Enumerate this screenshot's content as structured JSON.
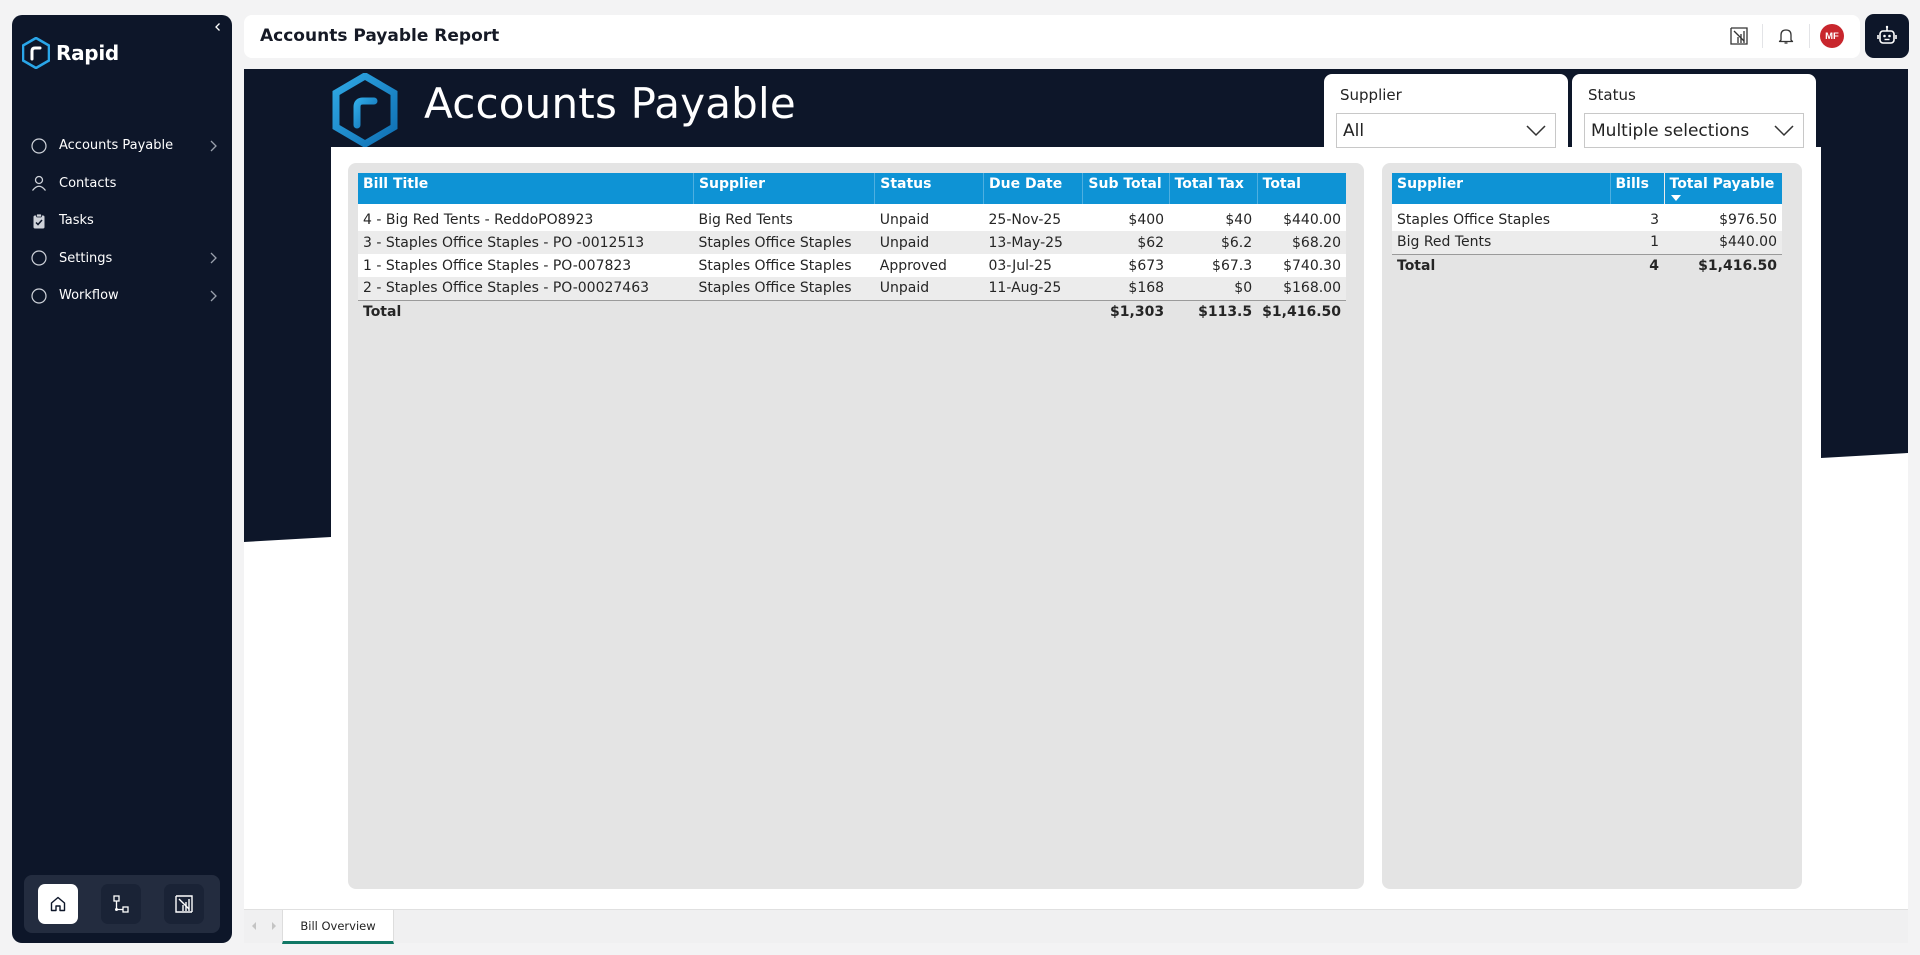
{
  "app": {
    "logo_text": "Rapid",
    "header_title": "Accounts Payable Report",
    "user_initials": "MF"
  },
  "sidebar": {
    "items": [
      {
        "label": "Accounts Payable",
        "icon": "circle-icon",
        "has_children": true
      },
      {
        "label": "Contacts",
        "icon": "person-icon",
        "has_children": false
      },
      {
        "label": "Tasks",
        "icon": "clipboard-check-icon",
        "has_children": false
      },
      {
        "label": "Settings",
        "icon": "circle-icon",
        "has_children": true
      },
      {
        "label": "Workflow",
        "icon": "circle-icon",
        "has_children": true
      }
    ],
    "bottom_buttons": [
      "home-icon",
      "workflow-icon",
      "report-icon"
    ]
  },
  "report": {
    "title": "Accounts Payable",
    "slicers": {
      "supplier": {
        "title": "Supplier",
        "value": "All"
      },
      "status": {
        "title": "Status",
        "value": "Multiple selections"
      }
    },
    "bills_table": {
      "columns": [
        "Bill Title",
        "Supplier",
        "Status",
        "Due Date",
        "Sub Total",
        "Total Tax",
        "Total"
      ],
      "rows": [
        [
          "4 - Big Red Tents - ReddoPO8923",
          "Big Red Tents",
          "Unpaid",
          "25-Nov-25",
          "$400",
          "$40",
          "$440.00"
        ],
        [
          "3 - Staples Office Staples - PO -0012513",
          "Staples Office Staples",
          "Unpaid",
          "13-May-25",
          "$62",
          "$6.2",
          "$68.20"
        ],
        [
          "1 - Staples Office Staples - PO-007823",
          "Staples Office Staples",
          "Approved",
          "03-Jul-25",
          "$673",
          "$67.3",
          "$740.30"
        ],
        [
          "2 - Staples Office Staples - PO-00027463",
          "Staples Office Staples",
          "Unpaid",
          "11-Aug-25",
          "$168",
          "$0",
          "$168.00"
        ]
      ],
      "total": {
        "label": "Total",
        "sub_total": "$1,303",
        "total_tax": "$113.5",
        "total": "$1,416.50"
      }
    },
    "supplier_table": {
      "columns": [
        "Supplier",
        "Bills",
        "Total Payable"
      ],
      "rows": [
        [
          "Staples Office Staples",
          "3",
          "$976.50"
        ],
        [
          "Big Red Tents",
          "1",
          "$440.00"
        ]
      ],
      "total": {
        "label": "Total",
        "bills": "4",
        "total_payable": "$1,416.50"
      }
    }
  },
  "tabs": [
    {
      "label": "Bill Overview",
      "active": true
    }
  ],
  "colors": {
    "navy": "#0d1629",
    "table_header": "#0e93d5",
    "avatar": "#c8262d",
    "active_tab": "#117865"
  }
}
